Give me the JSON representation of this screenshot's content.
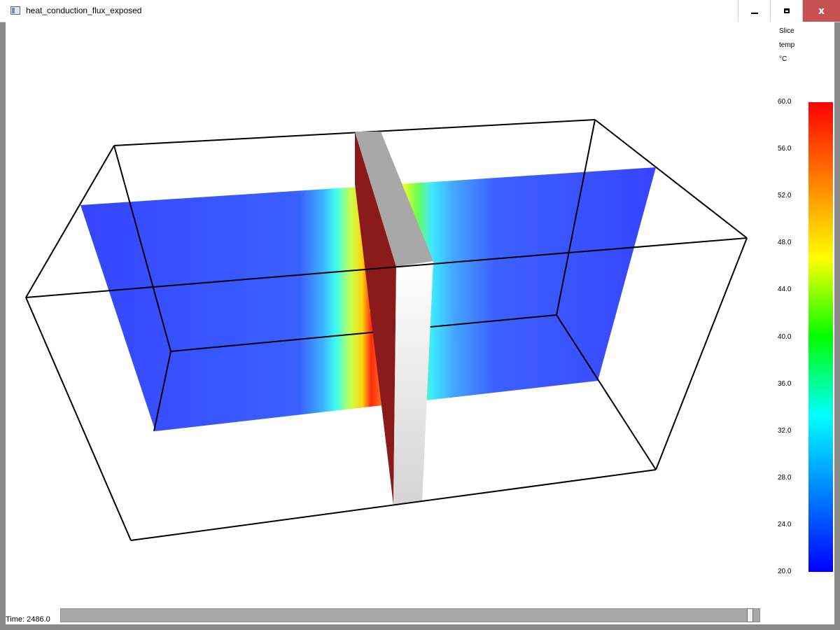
{
  "window": {
    "title": "heat_conduction_flux_exposed",
    "app_icon": "window-app-icon",
    "controls": {
      "minimize_icon": "minimize-icon",
      "maximize_icon": "maximize-icon",
      "close_icon": "close-icon",
      "close_glyph": "x"
    }
  },
  "legend": {
    "lines": [
      "Slice",
      "temp",
      "°C"
    ],
    "ticks": [
      "60.0",
      "56.0",
      "52.0",
      "48.0",
      "44.0",
      "40.0",
      "36.0",
      "32.0",
      "28.0",
      "24.0",
      "20.0"
    ],
    "min": 20.0,
    "max": 60.0,
    "colors": [
      "#0000ff",
      "#0080ff",
      "#00ffff",
      "#00ff00",
      "#ffff00",
      "#ff8000",
      "#ff0000"
    ]
  },
  "time": {
    "label": "Time: 2486.0",
    "slider_position": 0.99
  },
  "scene": {
    "box_edge_color": "#000000",
    "wall_top_color": "#a8a8a8",
    "wall_left_face_color": "#8b1a1a",
    "wall_front_face_color": "#f2f2f2",
    "slice_base_color": "#2b3bff"
  }
}
